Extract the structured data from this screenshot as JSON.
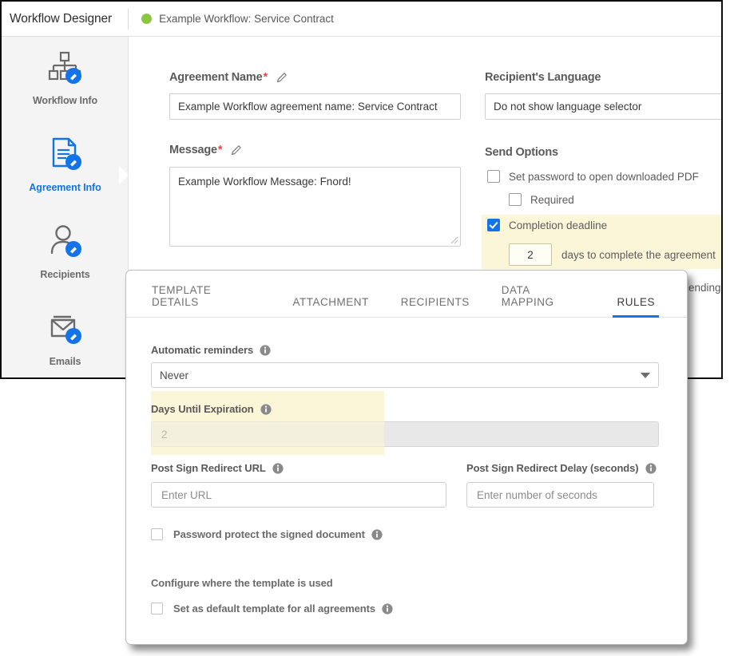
{
  "header": {
    "app_title": "Workflow Designer",
    "status_dot_color": "#8cc63e",
    "workflow_name": "Example Workflow: Service Contract"
  },
  "sidebar": {
    "items": [
      {
        "label": "Workflow Info",
        "icon": "org-chart-edit-icon",
        "active": false
      },
      {
        "label": "Agreement Info",
        "icon": "document-edit-icon",
        "active": true
      },
      {
        "label": "Recipients",
        "icon": "user-edit-icon",
        "active": false
      },
      {
        "label": "Emails",
        "icon": "email-image-edit-icon",
        "active": false
      }
    ]
  },
  "form": {
    "agreement_name": {
      "label": "Agreement Name",
      "required_marker": "*",
      "value": "Example Workflow agreement name: Service Contract"
    },
    "message": {
      "label": "Message",
      "required_marker": "*",
      "value": "Example Workflow Message: Fnord!"
    },
    "recipients_language": {
      "label": "Recipient's Language",
      "value": "Do not show language selector"
    },
    "send_options": {
      "title": "Send Options",
      "set_password": {
        "label": "Set password to open downloaded PDF",
        "checked": false
      },
      "required": {
        "label": "Required",
        "checked": false
      },
      "completion_deadline": {
        "label": "Completion deadline",
        "checked": true
      },
      "deadline_days": "2",
      "deadline_suffix": "days to complete the agreement",
      "partial_text": "ending"
    }
  },
  "modal": {
    "tabs": [
      {
        "label": "TEMPLATE DETAILS",
        "active": false
      },
      {
        "label": "ATTACHMENT",
        "active": false
      },
      {
        "label": "RECIPIENTS",
        "active": false
      },
      {
        "label": "DATA MAPPING",
        "active": false
      },
      {
        "label": "RULES",
        "active": true
      }
    ],
    "automatic_reminders": {
      "label": "Automatic reminders",
      "value": "Never"
    },
    "days_until_expiration": {
      "label": "Days Until Expiration",
      "value": "2"
    },
    "post_sign_redirect_url": {
      "label": "Post Sign Redirect URL",
      "placeholder": "Enter URL",
      "value": ""
    },
    "post_sign_redirect_delay": {
      "label": "Post Sign Redirect Delay (seconds)",
      "placeholder": "Enter number of seconds",
      "value": ""
    },
    "password_protect": {
      "label": "Password protect the signed document",
      "checked": false
    },
    "configure_heading": "Configure where the template is used",
    "set_default_template": {
      "label": "Set as default template for all agreements",
      "checked": false
    }
  },
  "colors": {
    "accent": "#1473e6",
    "status_green": "#8cc63e",
    "highlight": "#fcf6d8",
    "required_red": "#e34850"
  }
}
